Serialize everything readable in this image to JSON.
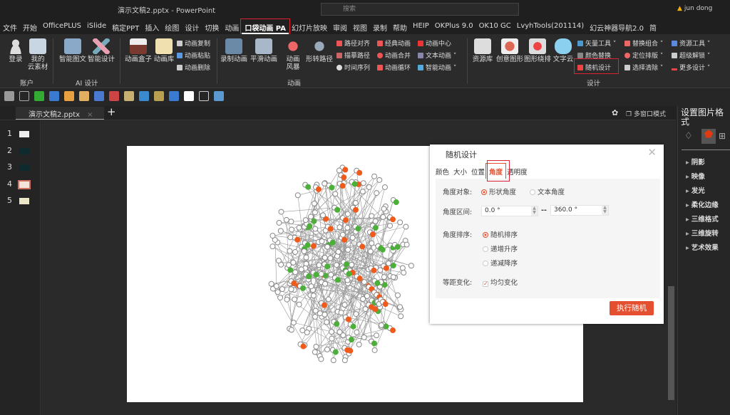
{
  "window": {
    "title": "演示文稿2.pptx  -  PowerPoint",
    "search_placeholder": "搜索",
    "user": "jun dong",
    "warning_icon": "warning-icon"
  },
  "tabs": [
    "文件",
    "开始",
    "OfficePLUS",
    "iSlide",
    "稿定PPT",
    "插入",
    "绘图",
    "设计",
    "切换",
    "动画",
    "口袋动画 PA",
    "幻灯片放映",
    "审阅",
    "视图",
    "录制",
    "帮助",
    "HEIP",
    "OKPlus 9.0",
    "OK10 GC",
    "LvyhTools(201114)",
    "幻云神器导航2.0",
    "简"
  ],
  "active_tab": "口袋动画 PA",
  "ribbon": {
    "account": {
      "login": "登录",
      "cloud": "我的\n云素材",
      "group": "账户"
    },
    "ai": {
      "smart_text": "智能图文",
      "smart_design": "智能设计",
      "group": "AI 设计"
    },
    "anim": {
      "box": "动画盒子",
      "lib": "动画库",
      "copy": "动画复制",
      "paste": "动画粘贴",
      "delete": "动画删除",
      "record": "录制动画",
      "smooth": "平滑动画",
      "storm": "动画\n风暴",
      "morph": "形转路径",
      "group": "动画",
      "path_align": "路径对齐",
      "trace_path": "描摹路径",
      "timeline": "时间序列",
      "classic": "经典动画",
      "merge": "动画合并",
      "loop": "动画循环",
      "center": "动画中心",
      "text_anim": "文本动画",
      "smart_anim": "智能动画"
    },
    "design": {
      "resource": "资源库",
      "creative": "创意图形",
      "arrange": "图形绕排",
      "wordcloud": "文字云",
      "vector": "矢量工具",
      "color_replace": "颜色替换",
      "random": "随机设计",
      "replace_group": "替换组合",
      "position": "定位排版",
      "select_clear": "选择清除",
      "res_tool": "资源工具",
      "unlock": "超级解锁",
      "more": "更多设计",
      "group": "设计"
    }
  },
  "document": {
    "tab": "演示文稿2.pptx",
    "multiwindow": "多窗口模式"
  },
  "thumbnails": [
    {
      "n": "1",
      "color": "#eeeeee"
    },
    {
      "n": "2",
      "color": "#0f2a2e"
    },
    {
      "n": "3",
      "color": "#0f2a2e"
    },
    {
      "n": "4",
      "color": "#f3e4dc",
      "selected": true
    },
    {
      "n": "5",
      "color": "#ece6c8"
    }
  ],
  "dialog": {
    "title": "随机设计",
    "tabs": [
      "颜色",
      "大小",
      "位置",
      "角度",
      "透明度"
    ],
    "active_tab": "角度",
    "angle_target_label": "角度对象:",
    "target_options": [
      "形状角度",
      "文本角度"
    ],
    "target_selected": "形状角度",
    "range_label": "角度区间:",
    "range_from": "0.0 °",
    "range_sep": "--",
    "range_to": "360.0 °",
    "order_label": "角度排序:",
    "order_options": [
      "随机排序",
      "递增升序",
      "递减降序"
    ],
    "order_selected": "随机排序",
    "equal_label": "等距变化:",
    "equal_checkbox": "均匀变化",
    "equal_checked": true,
    "run": "执行随机"
  },
  "right_pane": {
    "title": "设置图片格式",
    "items": [
      "阴影",
      "映像",
      "发光",
      "柔化边缘",
      "三维格式",
      "三维旋转",
      "艺术效果"
    ]
  },
  "colors": {
    "accent": "#e4502f",
    "highlight": "#dd2233",
    "flower": "#f05a1a",
    "leaf": "#4caf3a"
  }
}
